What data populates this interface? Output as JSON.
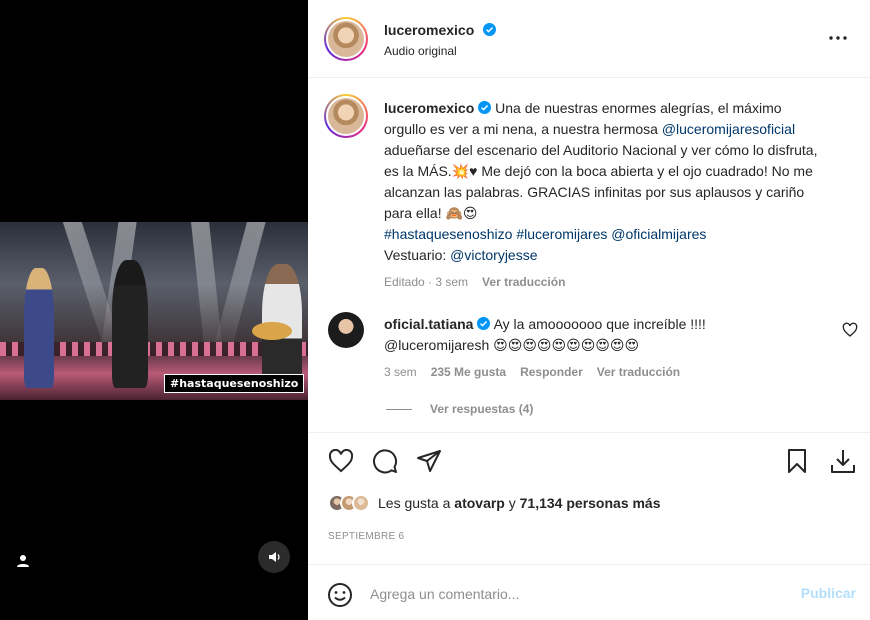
{
  "media": {
    "overlay_hashtag": "#hastaquesenoshizo"
  },
  "header": {
    "username": "luceromexico",
    "audio": "Audio original"
  },
  "caption": {
    "username": "luceromexico",
    "text_1": " Una de nuestras enormes alegrías, el máximo orgullo es ver a mi nena, a nuestra hermosa ",
    "mention_1": "@luceromijaresoficial",
    "text_2": " adueñarse del escenario del Auditorio Nacional y ver cómo lo disfruta, es la MÁS.💥♥ Me dejó con la boca abierta y el ojo cuadrado! No me alcanzan las palabras. GRACIAS infinitas por sus aplausos y cariño para ella! 🙈😍",
    "hashtag_1": "#hastaquesenoshizo",
    "hashtag_2": "#luceromijares",
    "mention_2": "@oficialmijares",
    "wardrobe_label": "Vestuario: ",
    "mention_3": "@victoryjesse",
    "edited": "Editado · 3 sem",
    "see_translation": "Ver traducción"
  },
  "comment": {
    "username": "oficial.tatiana",
    "text": " Ay la amooooooo que increíble !!!!",
    "mention": "@luceromijaresh",
    "emojis": " 😍😍😍😍😍😍😍😍😍😍",
    "time": "3 sem",
    "likes": "235 Me gusta",
    "reply": "Responder",
    "see_translation": "Ver traducción",
    "view_replies": "Ver respuestas (4)"
  },
  "likes": {
    "prefix": "Les gusta a ",
    "user": "atovarp",
    "middle": " y ",
    "count": "71,134 personas más"
  },
  "date": "SEPTIEMBRE 6",
  "comment_bar": {
    "placeholder": "Agrega un comentario...",
    "publish": "Publicar"
  },
  "colors": {
    "link": "#00376b",
    "verified": "#0095f6",
    "muted": "#8e8e8e",
    "publish_disabled": "#b2dffc"
  }
}
